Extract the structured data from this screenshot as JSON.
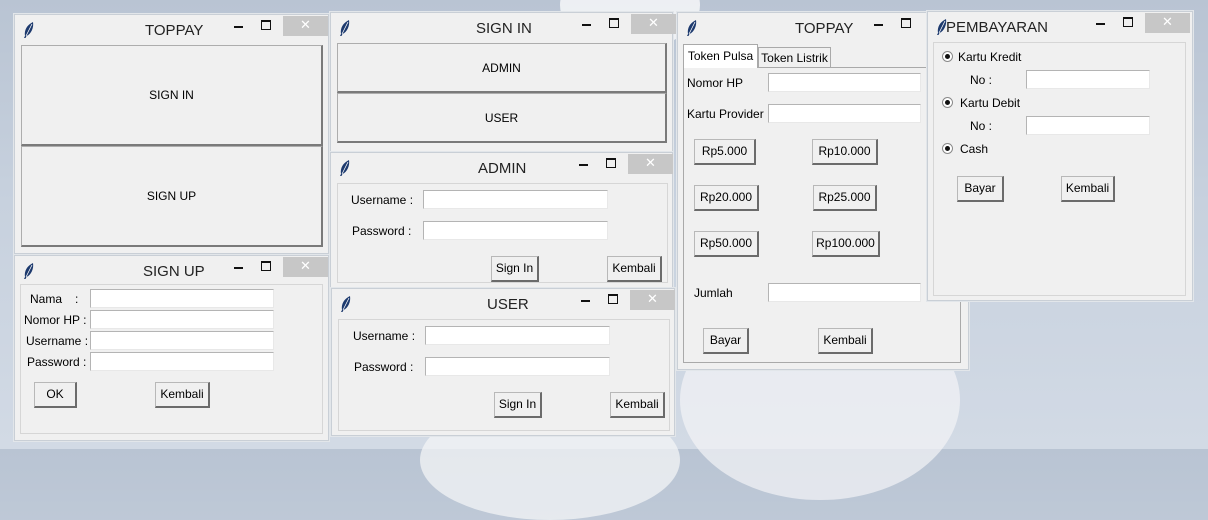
{
  "toppay_main": {
    "title": "TOPPAY",
    "signin_label": "SIGN IN",
    "signup_label": "SIGN UP"
  },
  "signin_window": {
    "title": "SIGN IN",
    "admin_label": "ADMIN",
    "user_label": "USER"
  },
  "admin_window": {
    "title": "ADMIN",
    "username_label": "Username :",
    "password_label": "Password :",
    "signin_label": "Sign In",
    "back_label": "Kembali"
  },
  "user_window": {
    "title": "USER",
    "username_label": "Username :",
    "password_label": "Password :",
    "signin_label": "Sign In",
    "back_label": "Kembali"
  },
  "signup_window": {
    "title": "SIGN UP",
    "name_label": "Nama",
    "name_colon": ":",
    "phone_label": "Nomor HP :",
    "username_label": "Username :",
    "password_label": "Password :",
    "ok_label": "OK",
    "back_label": "Kembali"
  },
  "topup_window": {
    "title": "TOPPAY",
    "tabs": [
      "Token Pulsa",
      "Token Listrik"
    ],
    "phone_label": "Nomor HP",
    "provider_label": "Kartu Provider",
    "amounts": [
      "Rp5.000",
      "Rp10.000",
      "Rp20.000",
      "Rp25.000",
      "Rp50.000",
      "Rp100.000"
    ],
    "qty_label": "Jumlah",
    "pay_label": "Bayar",
    "back_label": "Kembali"
  },
  "payment_window": {
    "title": "PEMBAYARAN",
    "credit_label": "Kartu Kredit",
    "credit_no_label": "No :",
    "debit_label": "Kartu Debit",
    "debit_no_label": "No :",
    "cash_label": "Cash",
    "pay_label": "Bayar",
    "back_label": "Kembali"
  },
  "window_controls": {
    "close_glyph": "✕"
  },
  "colors": {
    "window_bg": "#f0f0f0",
    "close_button": "#c7c7c7",
    "desktop": "#c4cedb"
  },
  "icons": [
    "feather-icon",
    "minimize-icon",
    "maximize-icon",
    "close-icon",
    "radio-selected-icon"
  ]
}
